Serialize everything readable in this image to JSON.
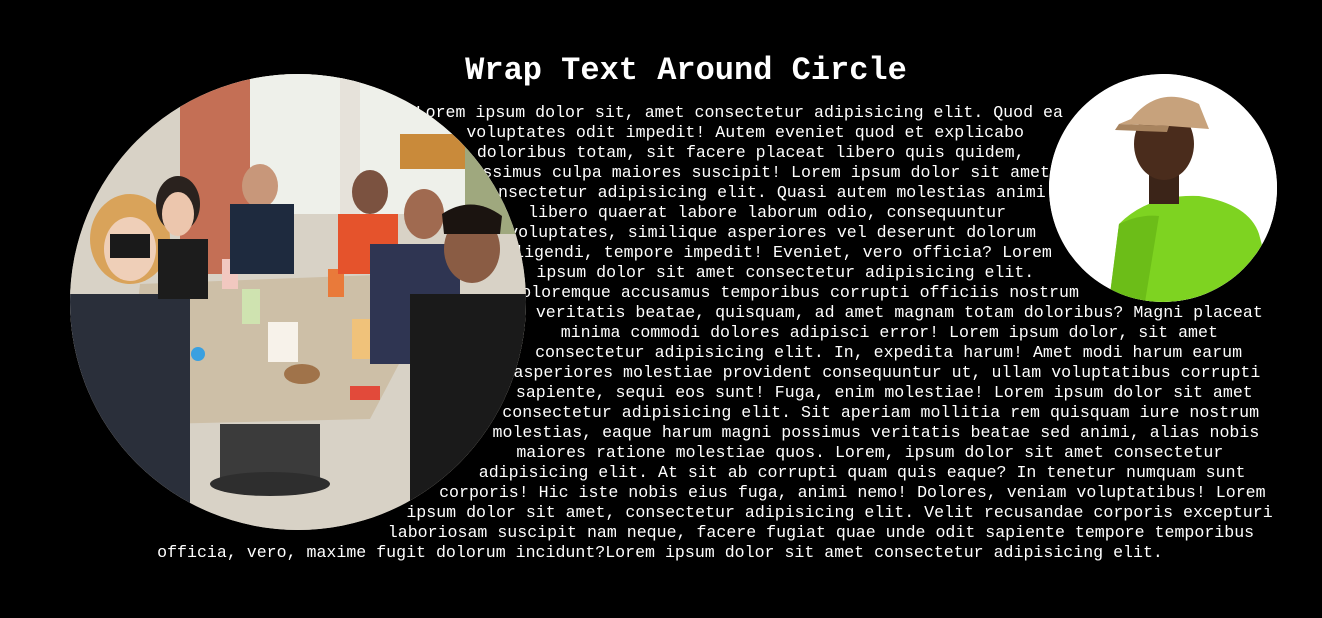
{
  "page": {
    "title": "Wrap Text Around Circle",
    "body_text": "Lorem ipsum dolor sit, amet consectetur adipisicing elit. Quod ea voluptates odit impedit! Autem eveniet quod et explicabo doloribus totam, sit facere placeat libero quis quidem, possimus culpa maiores suscipit! Lorem ipsum dolor sit amet consectetur adipisicing elit. Quasi autem molestias animi libero quaerat labore laborum odio, consequuntur voluptates, similique asperiores vel deserunt dolorum eligendi, tempore impedit! Eveniet, vero officia? Lorem ipsum dolor sit amet consectetur adipisicing elit. Doloremque accusamus temporibus corrupti officiis nostrum a veritatis beatae, quisquam, ad amet magnam totam doloribus? Magni placeat minima commodi dolores adipisci error! Lorem ipsum dolor, sit amet consectetur adipisicing elit. In, expedita harum! Amet modi harum earum asperiores molestiae provident consequuntur ut, ullam voluptatibus corrupti sapiente, sequi eos sunt! Fuga, enim molestiae! Lorem ipsum dolor sit amet consectetur adipisicing elit. Sit aperiam mollitia rem quisquam iure nostrum molestias, eaque harum magni possimus veritatis beatae sed animi, alias nobis maiores ratione molestiae quos. Lorem, ipsum dolor sit amet consectetur adipisicing elit. At sit ab corrupti quam quis eaque? In tenetur numquam sunt corporis! Hic iste nobis eius fuga, animi nemo! Dolores, veniam voluptatibus! Lorem ipsum dolor sit amet, consectetur adipisicing elit. Velit recusandae corporis excepturi laboriosam suscipit nam neque, facere fugiat quae unde odit sapiente tempore temporibus officia, vero, maxime fugit dolorum incidunt?Lorem ipsum dolor sit amet consectetur adipisicing elit."
  },
  "colors": {
    "background": "#000000",
    "text": "#ffffff"
  },
  "images": {
    "group_photo": "group-photo-circle",
    "portrait": "portrait-circle"
  }
}
